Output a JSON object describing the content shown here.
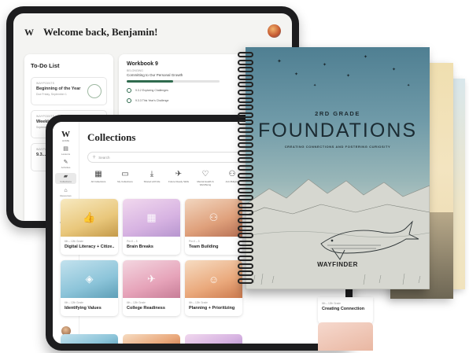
{
  "back_tablet": {
    "logo": "W",
    "welcome": "Welcome back, Benjamin!",
    "todo": {
      "title": "To-Do List",
      "items": [
        {
          "kicker": "WAYPOINTS",
          "title": "Beginning of the Year",
          "sub": "Due Friday, September 1"
        },
        {
          "kicker": "WAYPOINTS",
          "title": "Weekly Waypoints",
          "sub": "September 11 & 15"
        },
        {
          "kicker": "WAYPOINTS",
          "title": "9.3...",
          "sub": ""
        }
      ]
    },
    "workbook": {
      "title": "Workbook 9",
      "kicker": "BELONGING",
      "subtitle": "Committing to Our Personal Growth",
      "progress": 0.5,
      "rows": [
        {
          "label": "9.3.2 Exploring Challenges",
          "action": "Start"
        },
        {
          "label": "9.3.3 This Year's Challenge",
          "action": "Start"
        }
      ]
    }
  },
  "front_tablet": {
    "logo": "W",
    "logo_sub": "HOME",
    "sidebar": [
      {
        "icon": "▤",
        "label": "Lessons",
        "name": "lessons"
      },
      {
        "icon": "✎",
        "label": "Activities",
        "name": "activities"
      },
      {
        "icon": "▰",
        "label": "Collections",
        "name": "collections",
        "active": true
      },
      {
        "icon": "⌂",
        "label": "Resources",
        "name": "resources"
      },
      {
        "icon": "◔",
        "label": "Progress",
        "name": "progress"
      },
      {
        "icon": "◎",
        "label": "Resources",
        "name": "resources-2"
      },
      {
        "icon": "⚙",
        "label": "Settings",
        "name": "settings"
      }
    ],
    "title": "Collections",
    "search_placeholder": "Search",
    "quick_actions": [
      {
        "icon": "▦",
        "label": "All Collections",
        "name": "all-collections"
      },
      {
        "icon": "▭",
        "label": "My Collections",
        "name": "my-collections"
      },
      {
        "icon": "⤓",
        "label": "Shared with Me",
        "name": "shared-with-me"
      },
      {
        "icon": "✈",
        "label": "Future Ready Skills",
        "name": "future-ready-skills"
      },
      {
        "icon": "♡",
        "label": "Mental Health & Well-Being",
        "name": "mental-health"
      },
      {
        "icon": "⚇",
        "label": "Anti-Bullying",
        "name": "anti-bullying"
      }
    ],
    "cards": [
      {
        "kicker": "6th – 12th Grade",
        "title": "Digital Literacy + Citize...",
        "icon": "👍",
        "style": "g1"
      },
      {
        "kicker": "Pre-K – 5",
        "title": "Brain Breaks",
        "icon": "▦",
        "style": "g2"
      },
      {
        "kicker": "Pre-K – 5",
        "title": "Team Building",
        "icon": "⚇",
        "style": "g3"
      },
      {
        "kicker": "6th – 12th Grade",
        "title": "Identifying Values",
        "icon": "◈",
        "style": "g4"
      },
      {
        "kicker": "6th – 12th Grade",
        "title": "College Readiness",
        "icon": "✈",
        "style": "g5"
      },
      {
        "kicker": "6th – 12th Grade",
        "title": "Planning + Prioritizing",
        "icon": "☺",
        "style": "g6"
      }
    ],
    "extra_card": {
      "kicker": "6th – 12th Grade",
      "title": "Creating Connection"
    }
  },
  "workbooks": {
    "front": {
      "grade": "2RD GRADE",
      "title": "FOUNDATIONS",
      "tagline": "CREATING CONNECTIONS AND FOSTERING CURIOSITY",
      "brand": "WAYFINDER"
    },
    "behind_letter_1": "S",
    "behind_letter_2": "S"
  }
}
